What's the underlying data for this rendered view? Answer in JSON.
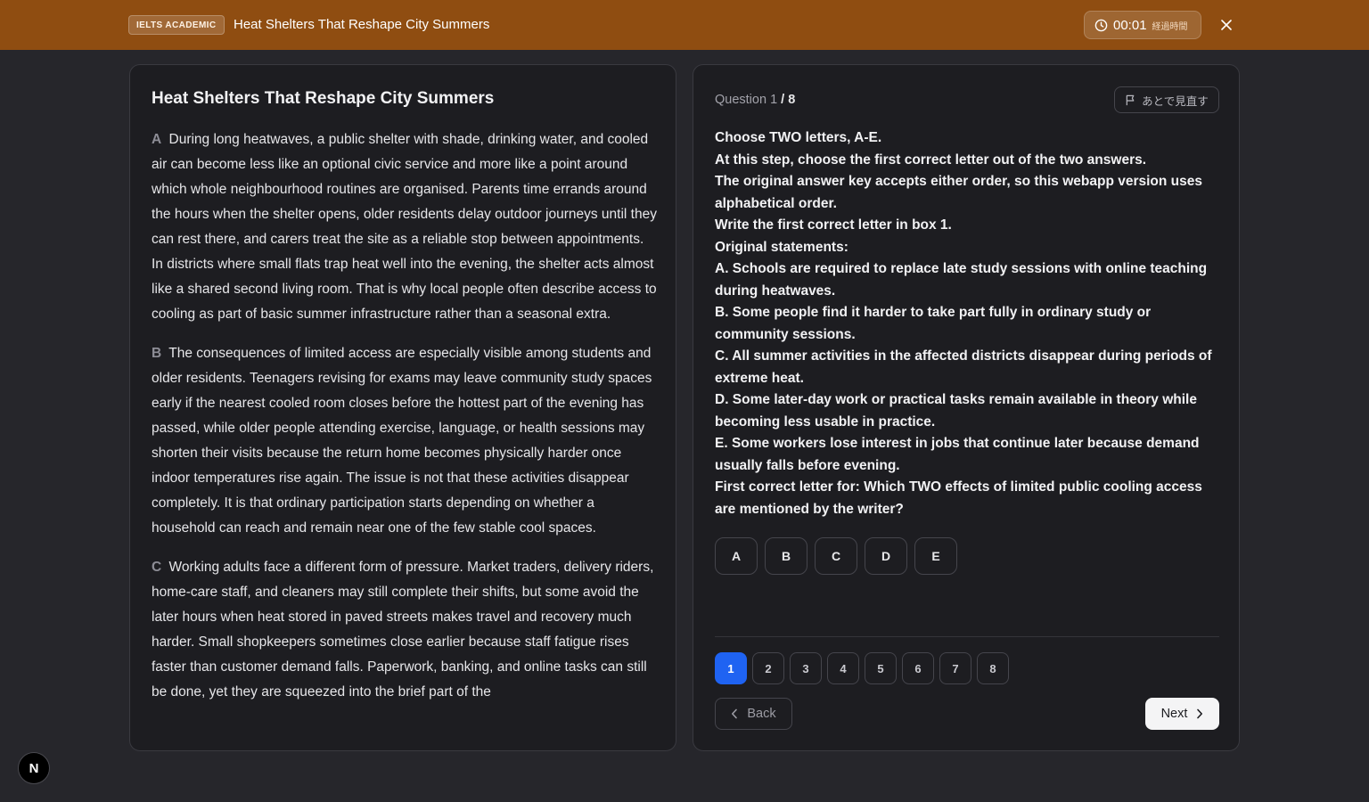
{
  "header": {
    "exam_badge": "IELTS ACADEMIC",
    "title": "Heat Shelters That Reshape City Summers",
    "timer_value": "00:01",
    "timer_label": "経過時間",
    "close_icon": "close-icon",
    "accent_color": "#8f4d11"
  },
  "passage": {
    "title": "Heat Shelters That Reshape City Summers",
    "paragraphs": [
      {
        "letter": "A",
        "text": "During long heatwaves, a public shelter with shade, drinking water, and cooled air can become less like an optional civic service and more like a point around which whole neighbourhood routines are organised. Parents time errands around the hours when the shelter opens, older residents delay outdoor journeys until they can rest there, and carers treat the site as a reliable stop between appointments. In districts where small flats trap heat well into the evening, the shelter acts almost like a shared second living room. That is why local people often describe access to cooling as part of basic summer infrastructure rather than a seasonal extra."
      },
      {
        "letter": "B",
        "text": "The consequences of limited access are especially visible among students and older residents. Teenagers revising for exams may leave community study spaces early if the nearest cooled room closes before the hottest part of the evening has passed, while older people attending exercise, language, or health sessions may shorten their visits because the return home becomes physically harder once indoor temperatures rise again. The issue is not that these activities disappear completely. It is that ordinary participation starts depending on whether a household can reach and remain near one of the few stable cool spaces."
      },
      {
        "letter": "C",
        "text": "Working adults face a different form of pressure. Market traders, delivery riders, home-care staff, and cleaners may still complete their shifts, but some avoid the later hours when heat stored in paved streets makes travel and recovery much harder. Small shopkeepers sometimes close earlier because staff fatigue rises faster than customer demand falls. Paperwork, banking, and online tasks can still be done, yet they are squeezed into the brief part of the"
      }
    ]
  },
  "question": {
    "counter_prefix": "Question 1",
    "counter_total": "/ 8",
    "flag_label": "あとで見直す",
    "flag_icon": "flag-icon",
    "lines": [
      "Choose TWO letters, A-E.",
      "At this step, choose the first correct letter out of the two answers.",
      "The original answer key accepts either order, so this webapp version uses alphabetical order.",
      "Write the first correct letter in box 1.",
      "Original statements:",
      "A. Schools are required to replace late study sessions with online teaching during heatwaves.",
      "B. Some people find it harder to take part fully in ordinary study or community sessions.",
      "C. All summer activities in the affected districts disappear during periods of extreme heat.",
      "D. Some later-day work or practical tasks remain available in theory while becoming less usable in practice.",
      "E. Some workers lose interest in jobs that continue later because demand usually falls before evening.",
      "First correct letter for: Which TWO effects of limited public cooling access are mentioned by the writer?"
    ],
    "options": [
      "A",
      "B",
      "C",
      "D",
      "E"
    ],
    "question_numbers": [
      "1",
      "2",
      "3",
      "4",
      "5",
      "6",
      "7",
      "8"
    ],
    "active_question": "1",
    "active_color": "#1f63f2",
    "back_label": "Back",
    "next_label": "Next"
  },
  "dev_badge": "N"
}
